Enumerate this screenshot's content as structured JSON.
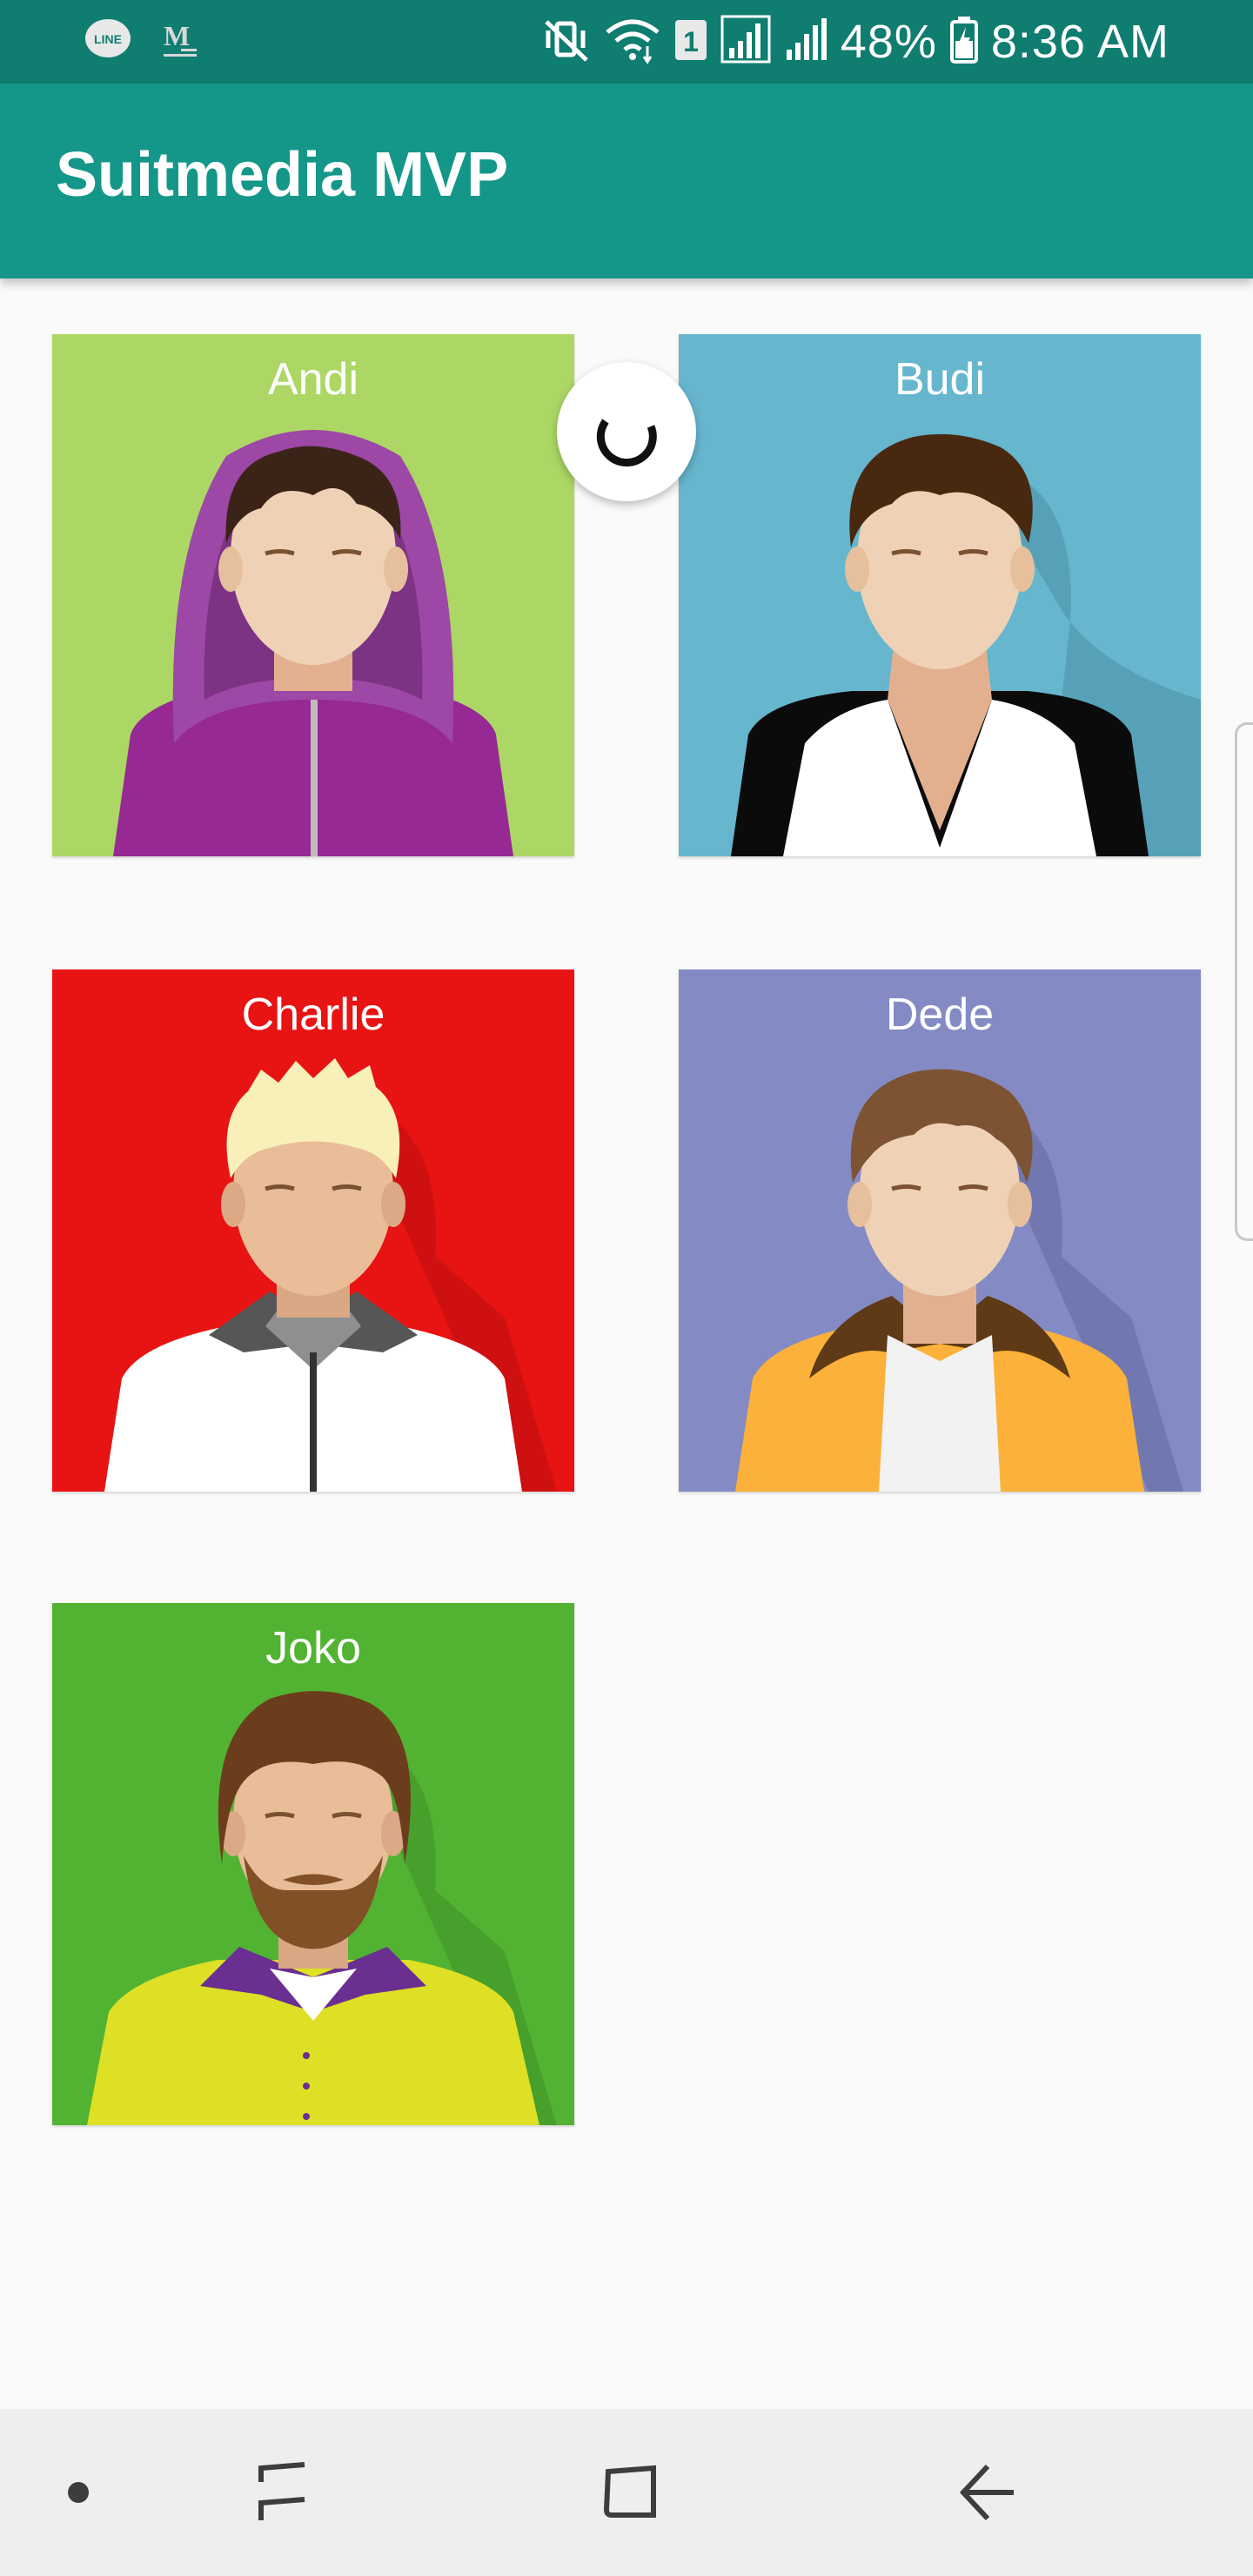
{
  "status_bar": {
    "left_icons": [
      "line-app-icon",
      "gmail-icon"
    ],
    "right_icons": [
      "vibrate-mute-icon",
      "wifi-icon",
      "sim-1-icon",
      "signal-icon-1",
      "signal-icon-2",
      "battery-icon"
    ],
    "battery": "48%",
    "time": "8:36 AM"
  },
  "app_bar": {
    "title": "Suitmedia MVP"
  },
  "people": [
    {
      "name": "Andi",
      "background": "#acd765"
    },
    {
      "name": "Budi",
      "background": "#66b6ce"
    },
    {
      "name": "Charlie",
      "background": "#e81313"
    },
    {
      "name": "Dede",
      "background": "#848bc4"
    },
    {
      "name": "Joko",
      "background": "#52b333"
    }
  ],
  "loading_indicator": "refresh-spinner-icon",
  "nav_bar": {
    "icons": [
      "dot-icon",
      "recent-apps-icon",
      "home-icon",
      "back-icon"
    ]
  }
}
